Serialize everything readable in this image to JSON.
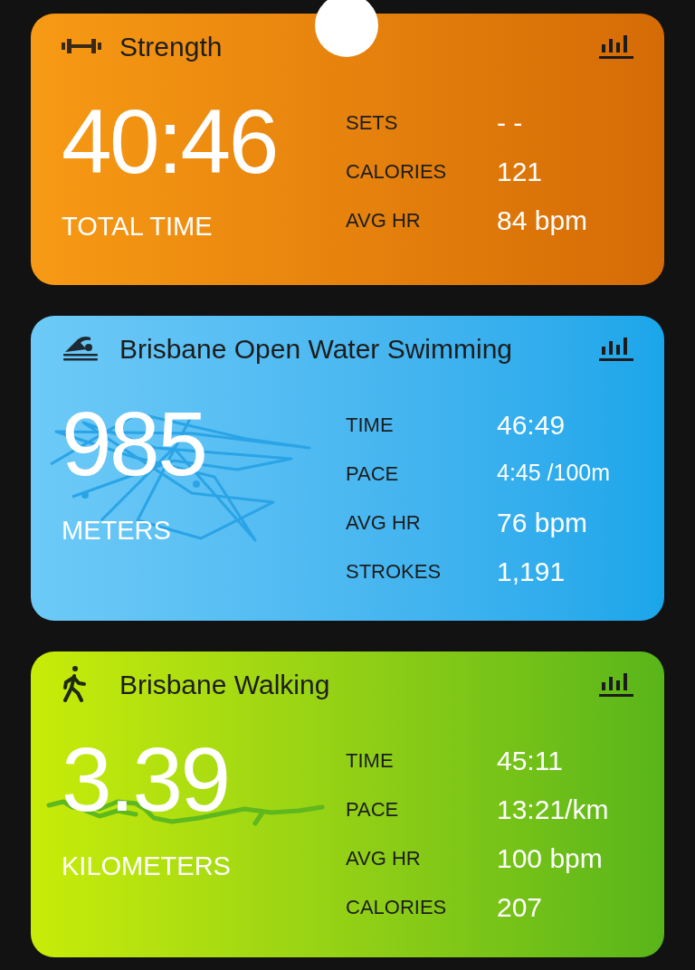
{
  "cards": [
    {
      "kind": "strength",
      "title": "Strength",
      "main_value": "40:46",
      "main_label": "TOTAL TIME",
      "stats": [
        {
          "label": "SETS",
          "value": "- -"
        },
        {
          "label": "CALORIES",
          "value": "121"
        },
        {
          "label": "AVG HR",
          "value": "84 bpm"
        }
      ]
    },
    {
      "kind": "swim",
      "title": "Brisbane Open Water Swimming",
      "main_value": "985",
      "main_label": "METERS",
      "stats": [
        {
          "label": "TIME",
          "value": "46:49"
        },
        {
          "label": "PACE",
          "value": "4:45 /100m"
        },
        {
          "label": "AVG HR",
          "value": "76 bpm"
        },
        {
          "label": "STROKES",
          "value": "1,191"
        }
      ]
    },
    {
      "kind": "walk",
      "title": "Brisbane Walking",
      "main_value": "3.39",
      "main_label": "KILOMETERS",
      "stats": [
        {
          "label": "TIME",
          "value": "45:11"
        },
        {
          "label": "PACE",
          "value": "13:21/km"
        },
        {
          "label": "AVG HR",
          "value": "100 bpm"
        },
        {
          "label": "CALORIES",
          "value": "207"
        }
      ]
    }
  ]
}
